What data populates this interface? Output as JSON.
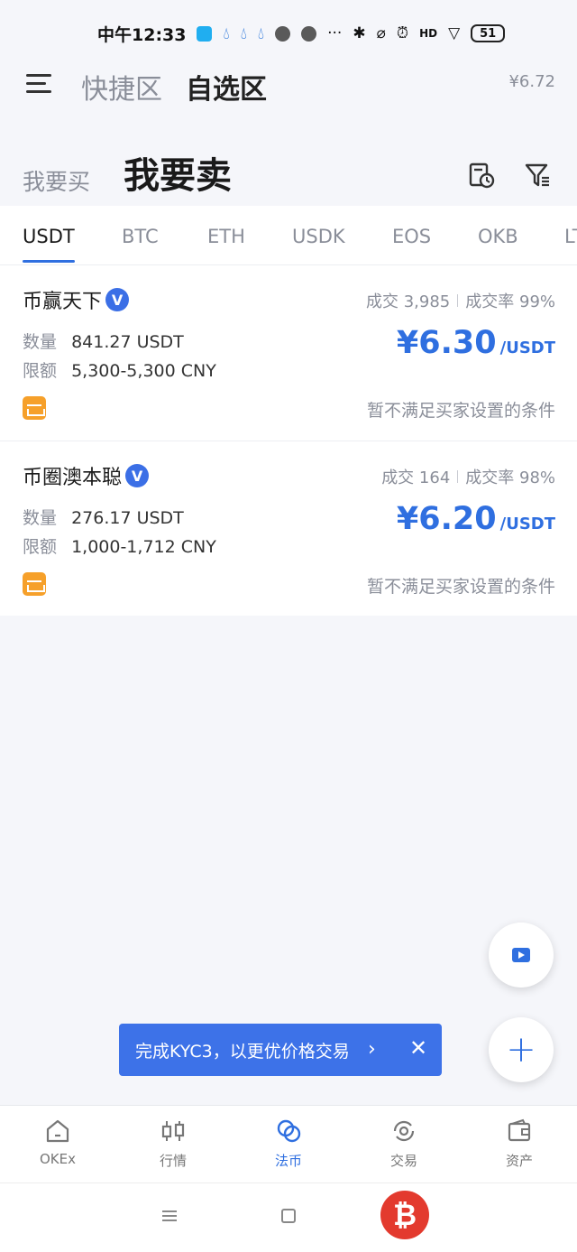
{
  "status_bar": {
    "time": "中午12:33",
    "battery": "51",
    "network": "HD"
  },
  "header": {
    "tab_quick": "快捷区",
    "tab_fav": "自选区",
    "rate": "¥6.72"
  },
  "trade_side": {
    "buy": "我要买",
    "sell": "我要卖"
  },
  "coin_tabs": [
    "USDT",
    "BTC",
    "ETH",
    "USDK",
    "EOS",
    "OKB",
    "LT"
  ],
  "ads": [
    {
      "merchant": "币赢天下",
      "verified_badge": "V",
      "deals": "成交 3,985",
      "rate": "成交率 99%",
      "amount_label": "数量",
      "amount": "841.27 USDT",
      "limit_label": "限额",
      "limit": "5,300-5,300 CNY",
      "price": "¥6.30",
      "unit": "/USDT",
      "notice": "暂不满足买家设置的条件"
    },
    {
      "merchant": "币圈澳本聪",
      "verified_badge": "V",
      "deals": "成交 164",
      "rate": "成交率 98%",
      "amount_label": "数量",
      "amount": "276.17 USDT",
      "limit_label": "限额",
      "limit": "1,000-1,712 CNY",
      "price": "¥6.20",
      "unit": "/USDT",
      "notice": "暂不满足买家设置的条件"
    }
  ],
  "fab": {
    "add": "+"
  },
  "kyc_banner": {
    "text": "完成KYC3，以更优价格交易",
    "chevron": "›",
    "close": "✕"
  },
  "bottom_nav": [
    {
      "label": "OKEx",
      "icon": "home-icon"
    },
    {
      "label": "行情",
      "icon": "candlestick-icon"
    },
    {
      "label": "法币",
      "icon": "fiat-icon"
    },
    {
      "label": "交易",
      "icon": "trade-icon"
    },
    {
      "label": "资产",
      "icon": "wallet-icon"
    }
  ],
  "colors": {
    "accent": "#2f6fe0",
    "pay_icon": "#f6a02a",
    "banner": "#3d72e8"
  }
}
